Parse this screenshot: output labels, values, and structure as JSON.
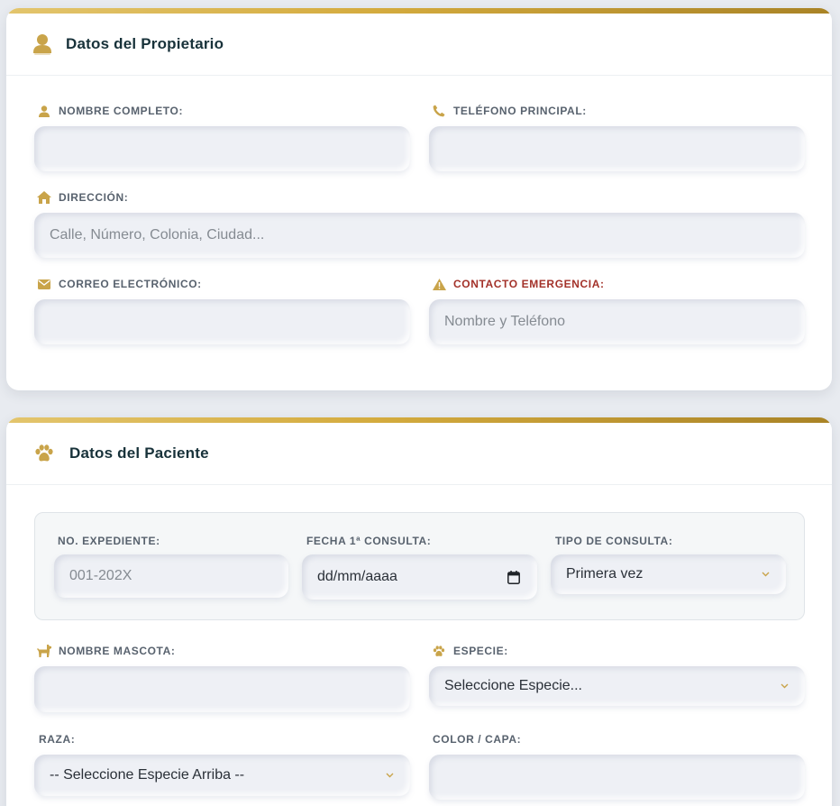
{
  "owner": {
    "title": "Datos del Propietario",
    "fields": {
      "nombre": {
        "label": "NOMBRE COMPLETO:",
        "value": "",
        "placeholder": ""
      },
      "telefono": {
        "label": "TELÉFONO PRINCIPAL:",
        "value": "",
        "placeholder": ""
      },
      "direccion": {
        "label": "DIRECCIÓN:",
        "value": "",
        "placeholder": "Calle, Número, Colonia, Ciudad..."
      },
      "correo": {
        "label": "CORREO ELECTRÓNICO:",
        "value": "",
        "placeholder": ""
      },
      "emergencia": {
        "label": "CONTACTO EMERGENCIA:",
        "value": "",
        "placeholder": "Nombre y Teléfono"
      }
    }
  },
  "patient": {
    "title": "Datos del Paciente",
    "fields": {
      "expediente": {
        "label": "NO. EXPEDIENTE:",
        "value": "",
        "placeholder": "001-202X"
      },
      "fecha": {
        "label": "FECHA 1ª CONSULTA:",
        "value": "dd/mm/aaaa"
      },
      "tipo": {
        "label": "TIPO DE CONSULTA:",
        "selected": "Primera vez"
      },
      "mascota": {
        "label": "NOMBRE MASCOTA:",
        "value": "",
        "placeholder": ""
      },
      "especie": {
        "label": "ESPECIE:",
        "selected": "Seleccione Especie..."
      },
      "raza": {
        "label": "RAZA:",
        "selected": "-- Seleccione Especie Arriba --"
      },
      "color": {
        "label": "COLOR / CAPA:",
        "value": "",
        "placeholder": ""
      }
    }
  },
  "colors": {
    "accent_gold": "#c9a44a",
    "warning_red": "#a3322a",
    "title_dark": "#18323a"
  }
}
